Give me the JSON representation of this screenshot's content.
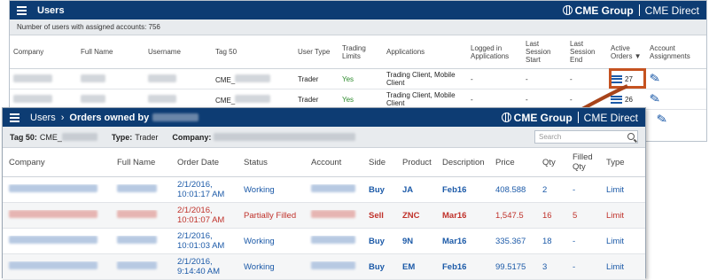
{
  "users_panel": {
    "title": "Users",
    "brand": "CME Group",
    "brand_product": "CME Direct",
    "count_text": "Number of users with assigned accounts: 756",
    "columns": [
      "Company",
      "Full Name",
      "Username",
      "Tag 50",
      "User Type",
      "Trading Limits",
      "Applications",
      "Logged in Applications",
      "Last Session Start",
      "Last Session End",
      "Active Orders ▼",
      "Account Assignments"
    ],
    "rows": [
      {
        "tag50": "CME_",
        "user_type": "Trader",
        "trading_limits": "Yes",
        "applications": "Trading Client, Mobile Client",
        "logged_in": "-",
        "last_start": "-",
        "last_end": "-",
        "active_orders": "27"
      },
      {
        "tag50": "CME_",
        "user_type": "Trader",
        "trading_limits": "Yes",
        "applications": "Trading Client, Mobile Client",
        "logged_in": "-",
        "last_start": "-",
        "last_end": "-",
        "active_orders": "26"
      }
    ]
  },
  "orders_panel": {
    "breadcrumb_root": "Users",
    "breadcrumb_current": "Orders owned by",
    "brand": "CME Group",
    "brand_product": "CME Direct",
    "tag50_label": "Tag 50:",
    "tag50_value": "CME_",
    "type_label": "Type:",
    "type_value": "Trader",
    "company_label": "Company:",
    "search_placeholder": "Search",
    "columns": [
      "Company",
      "Full Name",
      "Order Date",
      "Status",
      "Account",
      "Side",
      "Product",
      "Description",
      "Price",
      "Qty",
      "Filled Qty",
      "Type"
    ],
    "rows": [
      {
        "date": "2/1/2016,",
        "time": "10:01:17 AM",
        "status": "Working",
        "side": "Buy",
        "product": "JA",
        "description": "Feb16",
        "price": "408.588",
        "qty": "2",
        "filled": "-",
        "type": "Limit"
      },
      {
        "date": "2/1/2016,",
        "time": "10:01:07 AM",
        "status": "Partially Filled",
        "side": "Sell",
        "product": "ZNC",
        "description": "Mar16",
        "price": "1,547.5",
        "qty": "16",
        "filled": "5",
        "type": "Limit"
      },
      {
        "date": "2/1/2016,",
        "time": "10:01:03 AM",
        "status": "Working",
        "side": "Buy",
        "product": "9N",
        "description": "Mar16",
        "price": "335.367",
        "qty": "18",
        "filled": "-",
        "type": "Limit"
      },
      {
        "date": "2/1/2016,",
        "time": "9:14:40 AM",
        "status": "Working",
        "side": "Buy",
        "product": "EM",
        "description": "Feb16",
        "price": "99.5175",
        "qty": "3",
        "filled": "-",
        "type": "Limit"
      }
    ]
  },
  "colors": {
    "header_navy": "#0d3c73",
    "link_blue": "#1c5aa8",
    "sell_red": "#c0322b",
    "yes_green": "#2e8b2e",
    "highlight_orange": "#c55220"
  }
}
